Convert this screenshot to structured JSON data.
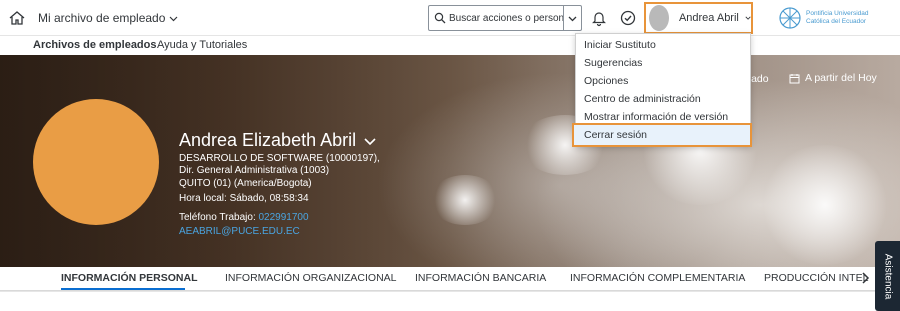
{
  "shell": {
    "app_title": "Mi archivo de empleado",
    "search_placeholder": "Buscar acciones o personas",
    "user_name": "Andrea Abril",
    "logo_line1": "Pontificia Universidad",
    "logo_line2": "Católica del Ecuador",
    "icons": [
      "home-icon",
      "chevron-down-icon",
      "search-icon",
      "bell-icon",
      "checkmark-circle-icon",
      "avatar",
      "logo-icon"
    ]
  },
  "subnav": {
    "item1": "Archivos de empleados",
    "item2": "Ayuda y Tutoriales"
  },
  "profile": {
    "name": "Andrea Elizabeth Abril",
    "department": "DESARROLLO DE SOFTWARE (10000197), Dir. General Administrativa (1003)",
    "location": "QUITO (01) (America/Bogota)",
    "local_time": "Hora local: Sábado, 08:58:34",
    "phone_label": "Teléfono Trabajo:",
    "phone": "022991700",
    "email": "AEABRIL@PUCE.EDU.EC",
    "action1": "ezado",
    "action2": "A partir del Hoy",
    "photo_color": "#e99d45"
  },
  "menu": {
    "items": [
      "Iniciar Sustituto",
      "Sugerencias",
      "Opciones",
      "Centro de administración",
      "Mostrar información de versión"
    ],
    "highlighted": "Cerrar sesión"
  },
  "tabs": {
    "items": [
      "INFORMACIÓN PERSONAL",
      "INFORMACIÓN ORGANIZACIONAL",
      "INFORMACIÓN BANCARIA",
      "INFORMACIÓN COMPLEMENTARIA",
      "PRODUCCIÓN INTEL"
    ],
    "active": "INFORMACIÓN PERSONAL"
  },
  "side_tab": "Asistencia",
  "colors": {
    "accent_orange": "#e8943a",
    "link_blue": "#4aa4e0",
    "tab_underline": "#0a6ed1"
  }
}
